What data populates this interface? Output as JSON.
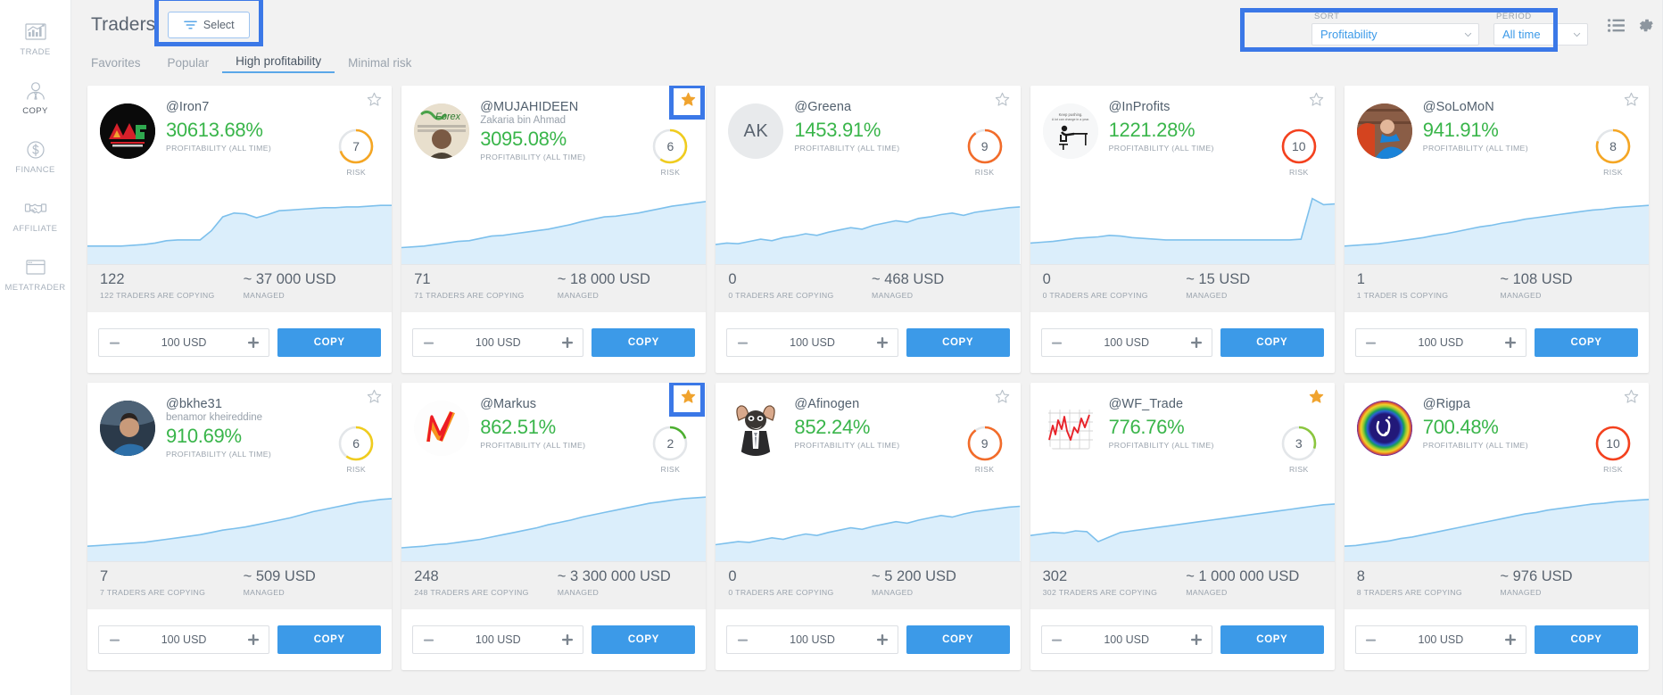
{
  "sidebar": {
    "items": [
      {
        "label": "TRADE",
        "icon": "chart-bars-icon",
        "active": false
      },
      {
        "label": "COPY",
        "icon": "person-tie-icon",
        "active": true
      },
      {
        "label": "FINANCE",
        "icon": "dollar-circle-icon",
        "active": false
      },
      {
        "label": "AFFILIATE",
        "icon": "handshake-icon",
        "active": false
      },
      {
        "label": "METATRADER",
        "icon": "browser-window-icon",
        "active": false
      }
    ]
  },
  "header": {
    "title": "Traders",
    "select_label": "Select",
    "select_icon": "filter-icon",
    "sort": {
      "label": "SORT",
      "value": "Profitability",
      "chevron": "chevron-down-icon"
    },
    "period": {
      "label": "PERIOD",
      "value": "All time",
      "chevron": "chevron-down-icon"
    },
    "list_view_icon": "list-view-icon",
    "settings_icon": "gear-icon"
  },
  "tabs": [
    {
      "label": "Favorites",
      "active": false
    },
    {
      "label": "Popular",
      "active": false
    },
    {
      "label": "High profitability",
      "active": true
    },
    {
      "label": "Minimal risk",
      "active": false
    }
  ],
  "colors": {
    "accent": "#3c9ae8",
    "highlight": "#3b78e7",
    "profit_green": "#39b54a",
    "star_on": "#f0a32e",
    "star_off": "#b9c1c9",
    "spark_fill": "#dbeefb",
    "spark_line": "#7dc0ec",
    "risk_low": "#4caf2f",
    "risk_mid_yellow": "#f0cc1e",
    "risk_orange": "#f5a623",
    "risk_high": "#f26c2a",
    "risk_max": "#f4411e"
  },
  "stepper_defaults": {
    "value": "100 USD",
    "minus": "minus-icon",
    "plus": "plus-icon"
  },
  "copy_label": "COPY",
  "profitability_label": "PROFITABILITY (ALL TIME)",
  "risk_label": "RISK",
  "managed_label": "MANAGED",
  "traders": [
    {
      "handle": "@Iron7",
      "realname": "",
      "profitability": "30613.68%",
      "risk": 7,
      "risk_color": "#f5a623",
      "risk_pct": 70,
      "starred": false,
      "star_highlighted": false,
      "copiers": "122",
      "copiers_label": "122 TRADERS ARE COPYING",
      "managed": "~ 37 000 USD",
      "amount": "100 USD",
      "avatar": {
        "type": "image-dark-logo",
        "bg": "#0b0b0b",
        "initials": ""
      },
      "spark": [
        20,
        20,
        20,
        20,
        21,
        22,
        24,
        27,
        28,
        28,
        28,
        40,
        58,
        63,
        62,
        57,
        61,
        66,
        67,
        68,
        69,
        70,
        70,
        71,
        71,
        72,
        73,
        73
      ]
    },
    {
      "handle": "@MUJAHIDEEN",
      "realname": "Zakaria bin Ahmad",
      "profitability": "3095.08%",
      "risk": 6,
      "risk_color": "#f0cc1e",
      "risk_pct": 60,
      "starred": true,
      "star_highlighted": true,
      "copiers": "71",
      "copiers_label": "71 TRADERS ARE COPYING",
      "managed": "~ 18 000 USD",
      "amount": "100 USD",
      "avatar": {
        "type": "image-forex-person",
        "bg": "#e4d9c6",
        "initials": ""
      },
      "spark": [
        18,
        19,
        20,
        22,
        24,
        26,
        27,
        30,
        33,
        34,
        36,
        38,
        40,
        42,
        45,
        48,
        52,
        55,
        58,
        59,
        61,
        63,
        66,
        69,
        72,
        74,
        76,
        78
      ]
    },
    {
      "handle": "@Greena",
      "realname": "",
      "profitability": "1453.91%",
      "risk": 9,
      "risk_color": "#f26c2a",
      "risk_pct": 90,
      "starred": false,
      "star_highlighted": false,
      "copiers": "0",
      "copiers_label": "0 TRADERS ARE COPYING",
      "managed": "~ 468 USD",
      "amount": "100 USD",
      "avatar": {
        "type": "initials",
        "bg": "#e8eaec",
        "initials": "AK"
      },
      "spark": [
        22,
        24,
        23,
        26,
        29,
        27,
        31,
        33,
        36,
        34,
        38,
        41,
        44,
        42,
        47,
        50,
        53,
        51,
        56,
        58,
        61,
        63,
        60,
        64,
        66,
        68,
        70,
        71
      ]
    },
    {
      "handle": "@InProfits",
      "realname": "",
      "profitability": "1221.28%",
      "risk": 10,
      "risk_color": "#f4411e",
      "risk_pct": 100,
      "starred": false,
      "star_highlighted": false,
      "copiers": "0",
      "copiers_label": "0 TRADERS ARE COPYING",
      "managed": "~ 15 USD",
      "amount": "100 USD",
      "avatar": {
        "type": "image-desk-person",
        "bg": "#f4f5f7",
        "initials": ""
      },
      "spark": [
        24,
        25,
        26,
        28,
        30,
        31,
        32,
        34,
        33,
        31,
        30,
        29,
        28,
        28,
        28,
        28,
        28,
        28,
        28,
        28,
        28,
        28,
        28,
        28,
        29,
        82,
        74,
        75
      ]
    },
    {
      "handle": "@SoLoMoN",
      "realname": "",
      "profitability": "941.91%",
      "risk": 8,
      "risk_color": "#f5a623",
      "risk_pct": 80,
      "starred": false,
      "star_highlighted": false,
      "copiers": "1",
      "copiers_label": "1 TRADER IS COPYING",
      "managed": "~ 108 USD",
      "amount": "100 USD",
      "avatar": {
        "type": "image-blue-person",
        "bg": "#c95f3a",
        "initials": ""
      },
      "spark": [
        20,
        21,
        22,
        23,
        25,
        27,
        29,
        31,
        34,
        36,
        39,
        42,
        45,
        47,
        50,
        52,
        55,
        57,
        59,
        61,
        63,
        65,
        67,
        68,
        70,
        71,
        72,
        73
      ]
    },
    {
      "handle": "@bkhe31",
      "realname": "benamor kheireddine",
      "profitability": "910.69%",
      "risk": 6,
      "risk_color": "#f0cc1e",
      "risk_pct": 60,
      "starred": false,
      "star_highlighted": false,
      "copiers": "7",
      "copiers_label": "7 TRADERS ARE COPYING",
      "managed": "~ 509 USD",
      "amount": "100 USD",
      "avatar": {
        "type": "image-man-car",
        "bg": "#2d3b4c",
        "initials": ""
      },
      "spark": [
        16,
        17,
        18,
        19,
        20,
        21,
        23,
        25,
        27,
        29,
        31,
        34,
        37,
        39,
        41,
        44,
        47,
        50,
        53,
        57,
        61,
        64,
        67,
        70,
        73,
        75,
        77,
        78
      ]
    },
    {
      "handle": "@Markus",
      "realname": "",
      "profitability": "862.51%",
      "risk": 2,
      "risk_color": "#4caf2f",
      "risk_pct": 20,
      "starred": true,
      "star_highlighted": true,
      "copiers": "248",
      "copiers_label": "248 TRADERS ARE COPYING",
      "managed": "~ 3 300 000 USD",
      "amount": "100 USD",
      "avatar": {
        "type": "image-m-logo",
        "bg": "#fafafa",
        "initials": ""
      },
      "spark": [
        14,
        15,
        16,
        18,
        19,
        21,
        23,
        25,
        28,
        31,
        34,
        37,
        40,
        44,
        47,
        50,
        54,
        57,
        60,
        63,
        66,
        69,
        72,
        74,
        76,
        78,
        79,
        80
      ]
    },
    {
      "handle": "@Afinogen",
      "realname": "",
      "profitability": "852.24%",
      "risk": 9,
      "risk_color": "#f26c2a",
      "risk_pct": 90,
      "starred": false,
      "star_highlighted": false,
      "copiers": "0",
      "copiers_label": "0 TRADERS ARE COPYING",
      "managed": "~ 5 200 USD",
      "amount": "100 USD",
      "avatar": {
        "type": "image-gremlin",
        "bg": "#ffffff",
        "initials": ""
      },
      "spark": [
        18,
        20,
        22,
        21,
        24,
        27,
        25,
        29,
        32,
        30,
        34,
        37,
        40,
        38,
        42,
        45,
        48,
        46,
        50,
        53,
        56,
        54,
        58,
        61,
        63,
        65,
        67,
        68
      ]
    },
    {
      "handle": "@WF_Trade",
      "realname": "",
      "profitability": "776.76%",
      "risk": 3,
      "risk_color": "#8bc63e",
      "risk_pct": 30,
      "starred": true,
      "star_highlighted": false,
      "copiers": "302",
      "copiers_label": "302 TRADERS ARE COPYING",
      "managed": "~ 1 000 000 USD",
      "amount": "100 USD",
      "avatar": {
        "type": "image-chart-grid",
        "bg": "#ffffff",
        "initials": ""
      },
      "spark": [
        30,
        32,
        34,
        33,
        36,
        35,
        22,
        28,
        34,
        36,
        38,
        40,
        42,
        44,
        46,
        48,
        50,
        52,
        54,
        56,
        58,
        60,
        62,
        64,
        66,
        68,
        70,
        71
      ]
    },
    {
      "handle": "@Rigpa",
      "realname": "",
      "profitability": "700.48%",
      "risk": 10,
      "risk_color": "#f4411e",
      "risk_pct": 100,
      "starred": false,
      "star_highlighted": false,
      "copiers": "8",
      "copiers_label": "8 TRADERS ARE COPYING",
      "managed": "~ 976 USD",
      "amount": "100 USD",
      "avatar": {
        "type": "image-rainbow-circle",
        "bg": "#221879",
        "initials": ""
      },
      "spark": [
        16,
        17,
        19,
        21,
        23,
        26,
        28,
        31,
        34,
        37,
        40,
        43,
        46,
        49,
        52,
        55,
        58,
        60,
        63,
        65,
        67,
        69,
        71,
        72,
        74,
        75,
        76,
        77
      ]
    }
  ]
}
